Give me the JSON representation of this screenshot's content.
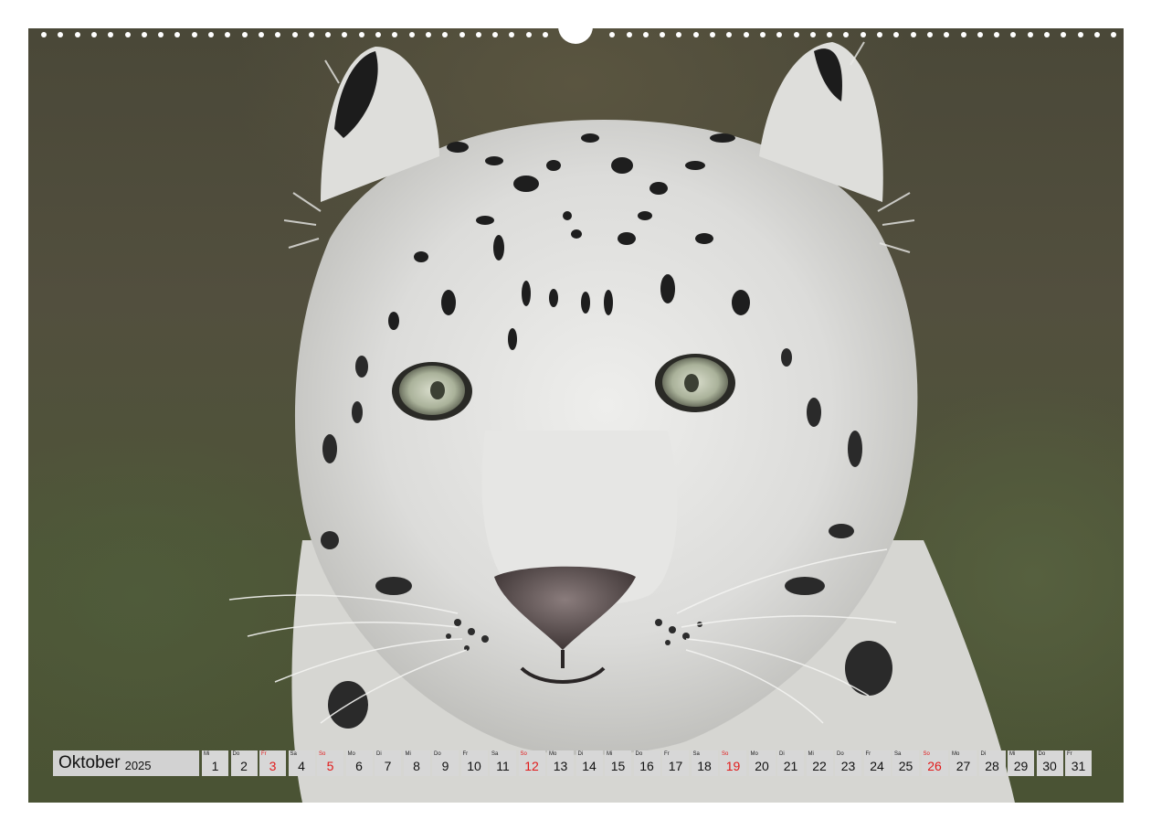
{
  "calendar": {
    "month": "Oktober",
    "year": "2025",
    "holiday_color": "#e11919",
    "days": [
      {
        "wd": "Mi",
        "num": "1",
        "red": false
      },
      {
        "wd": "Do",
        "num": "2",
        "red": false
      },
      {
        "wd": "Fr",
        "num": "3",
        "red": true
      },
      {
        "wd": "Sa",
        "num": "4",
        "red": false
      },
      {
        "wd": "So",
        "num": "5",
        "red": true
      },
      {
        "wd": "Mo",
        "num": "6",
        "red": false
      },
      {
        "wd": "Di",
        "num": "7",
        "red": false
      },
      {
        "wd": "Mi",
        "num": "8",
        "red": false
      },
      {
        "wd": "Do",
        "num": "9",
        "red": false
      },
      {
        "wd": "Fr",
        "num": "10",
        "red": false
      },
      {
        "wd": "Sa",
        "num": "11",
        "red": false
      },
      {
        "wd": "So",
        "num": "12",
        "red": true
      },
      {
        "wd": "Mo",
        "num": "13",
        "red": false
      },
      {
        "wd": "Di",
        "num": "14",
        "red": false
      },
      {
        "wd": "Mi",
        "num": "15",
        "red": false
      },
      {
        "wd": "Do",
        "num": "16",
        "red": false
      },
      {
        "wd": "Fr",
        "num": "17",
        "red": false
      },
      {
        "wd": "Sa",
        "num": "18",
        "red": false
      },
      {
        "wd": "So",
        "num": "19",
        "red": true
      },
      {
        "wd": "Mo",
        "num": "20",
        "red": false
      },
      {
        "wd": "Di",
        "num": "21",
        "red": false
      },
      {
        "wd": "Mi",
        "num": "22",
        "red": false
      },
      {
        "wd": "Do",
        "num": "23",
        "red": false
      },
      {
        "wd": "Fr",
        "num": "24",
        "red": false
      },
      {
        "wd": "Sa",
        "num": "25",
        "red": false
      },
      {
        "wd": "So",
        "num": "26",
        "red": true
      },
      {
        "wd": "Mo",
        "num": "27",
        "red": false
      },
      {
        "wd": "Di",
        "num": "28",
        "red": false
      },
      {
        "wd": "Mi",
        "num": "29",
        "red": false
      },
      {
        "wd": "Do",
        "num": "30",
        "red": false
      },
      {
        "wd": "Fr",
        "num": "31",
        "red": false
      }
    ]
  },
  "photo": {
    "subject": "snow-leopard-face",
    "background_color": "#4e5238",
    "fur_color": "#e3e3e1",
    "spot_color": "#1e1e1e",
    "eye_color": "#b9c0aa"
  }
}
